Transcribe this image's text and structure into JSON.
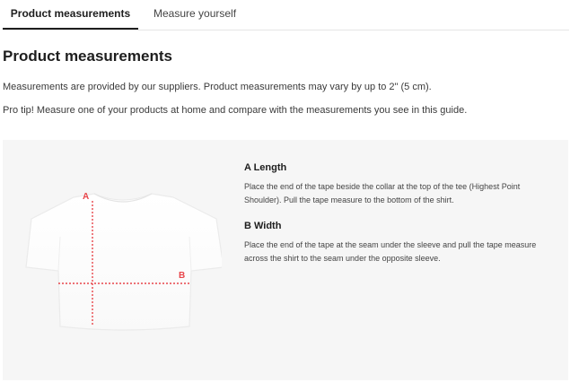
{
  "tabs": [
    {
      "label": "Product measurements",
      "active": true
    },
    {
      "label": "Measure yourself",
      "active": false
    }
  ],
  "content": {
    "title": "Product measurements",
    "intro": "Measurements are provided by our suppliers. Product measurements may vary by up to 2\" (5 cm).",
    "tip": "Pro tip! Measure one of your products at home and compare with the measurements you see in this guide."
  },
  "guide": {
    "illustration": {
      "label_a": "A",
      "label_b": "B",
      "marker_color": "#e8454a"
    },
    "measurements": [
      {
        "title": "A Length",
        "description": "Place the end of the tape beside the collar at the top of the tee (Highest Point Shoulder). Pull the tape measure to the bottom of the shirt."
      },
      {
        "title": "B Width",
        "description": "Place the end of the tape at the seam under the sleeve and pull the tape measure across the shirt to the seam under the opposite sleeve."
      }
    ]
  },
  "colors": {
    "panel_background": "#f6f6f6",
    "active_tab_underline": "#1e1e1e"
  }
}
